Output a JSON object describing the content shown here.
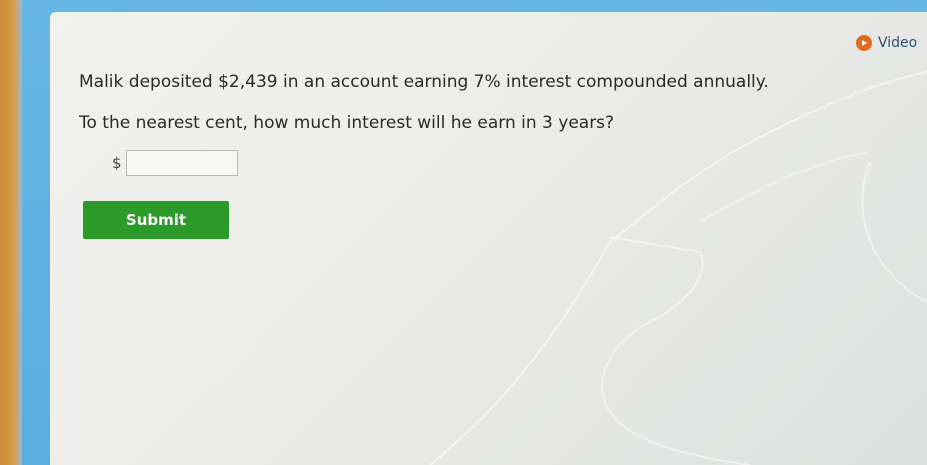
{
  "video": {
    "label": "Video",
    "icon": "play-icon",
    "icon_color": "#e06a1e"
  },
  "question": {
    "line1": "Malik deposited $2,439 in an account earning 7% interest compounded annually.",
    "line2": "To the nearest cent, how much interest will he earn in 3 years?"
  },
  "answer": {
    "prefix": "$",
    "value": "",
    "placeholder": ""
  },
  "submit": {
    "label": "Submit",
    "color": "#2c9b2a"
  }
}
